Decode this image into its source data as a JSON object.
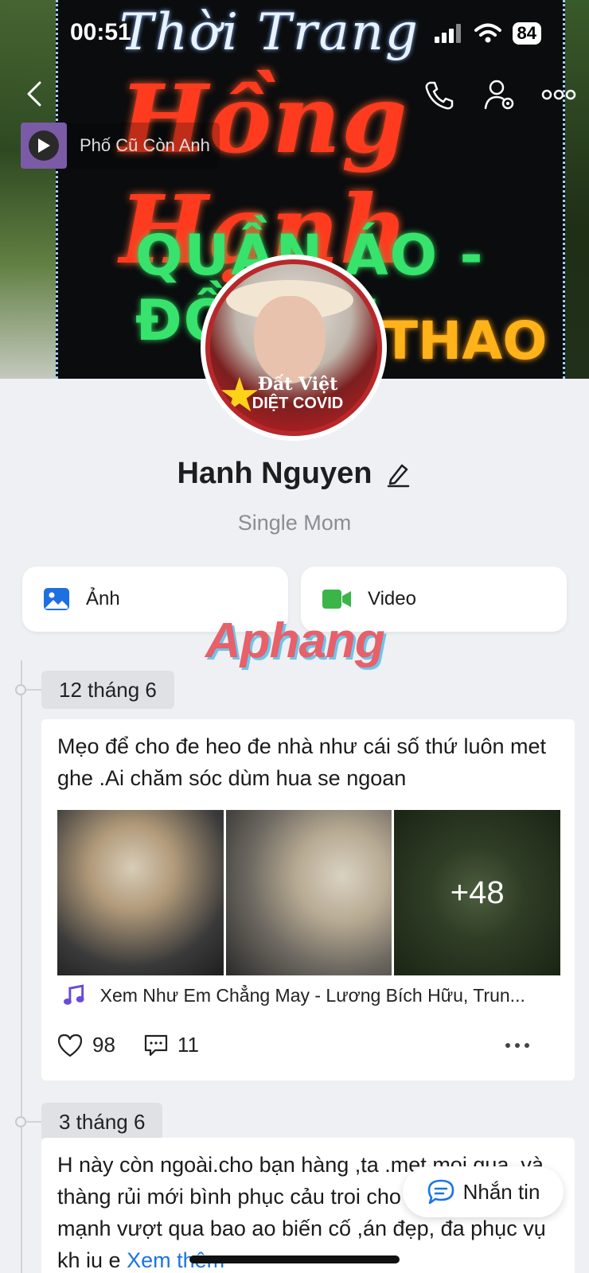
{
  "status": {
    "time": "00:51",
    "battery": "84"
  },
  "cover": {
    "sign_line1": "Thời Trang",
    "sign_line2": "Hồng Hạnh",
    "sign_line3": "QUẦN ÁO - ĐỒ LÓT",
    "sign_line4": "THAO"
  },
  "music": {
    "title": "Phố Cũ Còn Anh"
  },
  "avatar": {
    "badge_line1": "Đất Việt",
    "badge_line2": "DIỆT COVID"
  },
  "profile": {
    "name": "Hanh Nguyen",
    "bio": "Single Mom"
  },
  "media_buttons": {
    "photo": "Ảnh",
    "video": "Video"
  },
  "watermark": "Aphang",
  "posts": [
    {
      "date": "12 tháng 6",
      "text": "Mẹo để cho đe heo đe nhà như cái số thứ luôn met ghe .Ai chăm sóc dùm hua se ngoan",
      "more_photos": "+48",
      "song": "Xem Như Em Chẳng May - Lương Bích Hữu, Trun...",
      "likes": "98",
      "comments": "11"
    },
    {
      "date": "3 tháng 6",
      "text": "H này còn ngoài.cho  bạn hàng ,ta .met moi qua .và thàng rủi mới bình phục  cảu troi cho mình đu sức mạnh vượt qua bao ao biến cố ,án đẹp, đa phục vụ kh iu e",
      "see_more": "Xem thêm"
    }
  ],
  "message_button": "Nhắn tin",
  "colors": {
    "accent_blue": "#1a73e8",
    "video_green": "#3bb54a",
    "photo_blue": "#1e6fe0",
    "music_purple": "#6a4bd6"
  }
}
